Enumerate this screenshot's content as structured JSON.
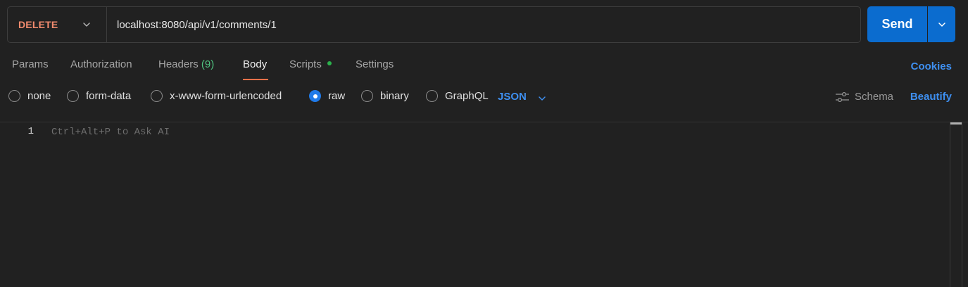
{
  "colors": {
    "method_delete": "#f28b6e",
    "accent_blue": "#3e8ff0",
    "send_bg": "#0b6ccf",
    "tab_underline": "#e8714a",
    "headers_count": "#4fc27f",
    "scripts_dot": "#2bb24c",
    "radio_checked": "#1f7ae8"
  },
  "request": {
    "method": "DELETE",
    "url": "localhost:8080/api/v1/comments/1",
    "send_label": "Send"
  },
  "tabs": {
    "params": "Params",
    "authorization": "Authorization",
    "headers": "Headers",
    "headers_count": "(9)",
    "body": "Body",
    "scripts": "Scripts",
    "settings": "Settings",
    "active": "Body",
    "cookies": "Cookies"
  },
  "body_types": {
    "options": [
      "none",
      "form-data",
      "x-www-form-urlencoded",
      "raw",
      "binary",
      "GraphQL"
    ],
    "selected": "raw",
    "format": "JSON",
    "schema": "Schema",
    "beautify": "Beautify"
  },
  "editor": {
    "line_numbers": [
      "1"
    ],
    "placeholder": "Ctrl+Alt+P to Ask AI"
  },
  "icons": {
    "method_dropdown": "chevron-down-icon",
    "send_dropdown": "chevron-down-icon",
    "format_dropdown": "chevron-down-icon",
    "schema": "sliders-icon"
  }
}
